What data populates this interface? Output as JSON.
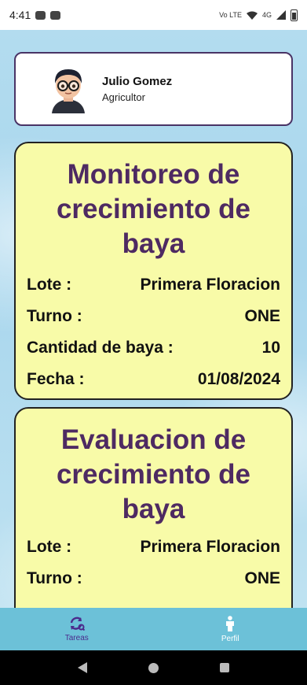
{
  "status_bar": {
    "time": "4:41",
    "network": "Vo LTE",
    "signal": "4G"
  },
  "profile": {
    "name": "Julio Gomez",
    "role": "Agricultor"
  },
  "tasks": [
    {
      "title": "Monitoreo de crecimiento de baya",
      "fields": [
        {
          "label": "Lote :",
          "value": "Primera Floracion"
        },
        {
          "label": "Turno :",
          "value": "ONE"
        },
        {
          "label": "Cantidad de baya :",
          "value": "10"
        },
        {
          "label": "Fecha :",
          "value": "01/08/2024"
        }
      ]
    },
    {
      "title": "Evaluacion de crecimiento de baya",
      "fields": [
        {
          "label": "Lote :",
          "value": "Primera Floracion"
        },
        {
          "label": "Turno :",
          "value": "ONE"
        }
      ]
    }
  ],
  "bottom_nav": {
    "items": [
      {
        "label": "Tareas",
        "icon": "tasks-sync-icon",
        "active": true
      },
      {
        "label": "Perfil",
        "icon": "person-icon",
        "active": false
      }
    ]
  },
  "colors": {
    "card_bg": "#f8fba8",
    "title_color": "#4e2a62",
    "nav_bg": "#6cc1d8",
    "active_nav": "#4b2b8c"
  }
}
